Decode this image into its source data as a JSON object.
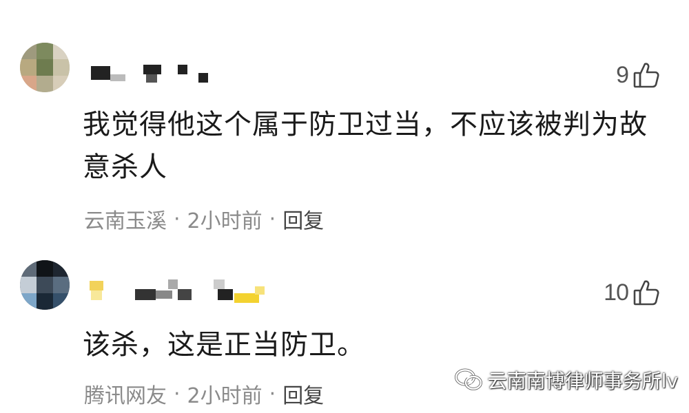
{
  "comments": [
    {
      "likes": "9",
      "text": "我觉得他这个属于防卫过当，不应该被判为故意杀人",
      "location": "云南玉溪",
      "time": "2小时前",
      "reply_label": "回复",
      "separator": "·"
    },
    {
      "likes": "10",
      "text": "该杀，这是正当防卫。",
      "location": "腾讯网友",
      "time": "2小时前",
      "reply_label": "回复",
      "separator": "·"
    }
  ],
  "watermark": {
    "text": "云南南博律师事务所lv",
    "icon": "wechat-icon"
  },
  "icons": {
    "like": "thumbs-up-icon"
  },
  "colors": {
    "text": "#1a1a1a",
    "meta": "#8a8a8a",
    "like_count": "#555555"
  }
}
